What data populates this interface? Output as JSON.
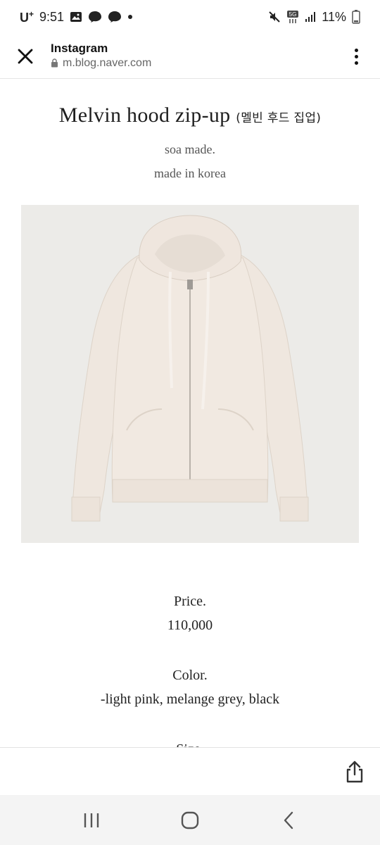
{
  "status_bar": {
    "carrier": "U",
    "carrier_sup": "+",
    "time": "9:51",
    "network": "5G",
    "battery": "11%"
  },
  "browser": {
    "title": "Instagram",
    "url": "m.blog.naver.com"
  },
  "product": {
    "name": "Melvin hood zip-up",
    "name_ko": "(멜빈 후드 집업)",
    "brand": "soa made.",
    "origin": "made in korea",
    "image_color": "#ede6de",
    "price_label": "Price.",
    "price": "110,000",
    "color_label": "Color.",
    "colors": "-light pink, melange grey, black",
    "size_label_partial": "Size."
  },
  "colors": {
    "divider": "#e6e6e6",
    "nav_bg": "#f4f4f4",
    "photo_bg": "#ecebe8",
    "hoodie": "#efe7df"
  },
  "icons": [
    "close-icon",
    "lock-icon",
    "more-vert-icon",
    "share-icon",
    "recents-icon",
    "home-icon",
    "back-icon"
  ]
}
